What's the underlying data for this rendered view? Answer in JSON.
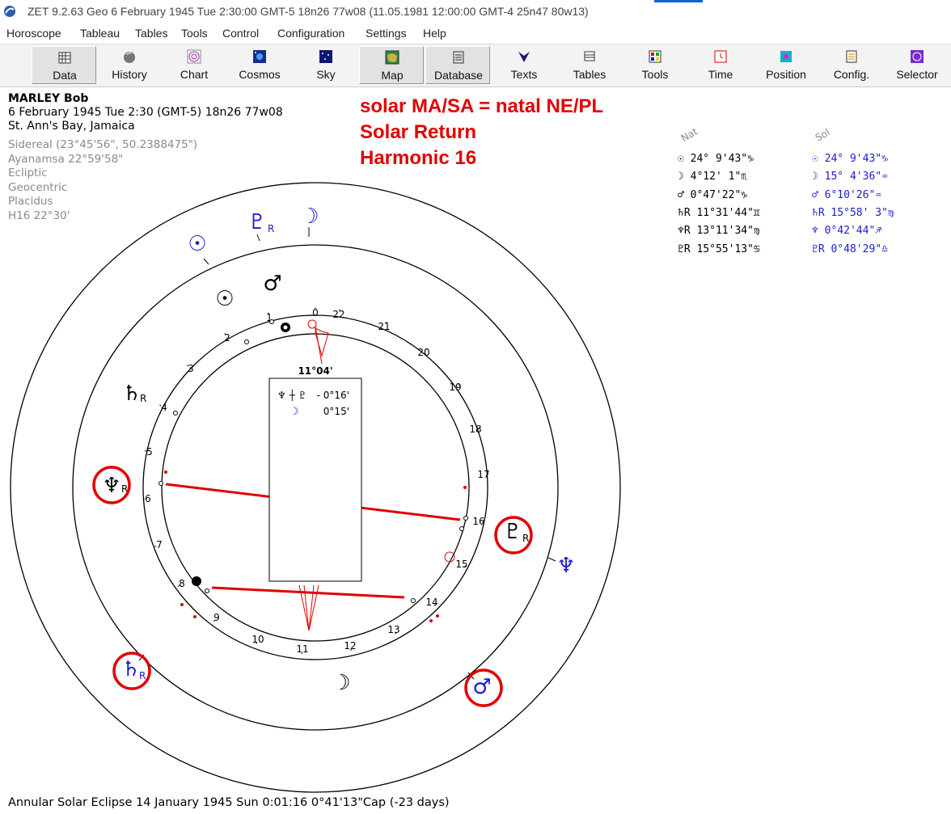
{
  "window": {
    "title": "ZET 9.2.63 Geo    6 February 1945  Tue   2:30:00 GMT-5 18n26  77w08  (11.05.1981  12:00:00 GMT-4 25n47 80w13)"
  },
  "menu": [
    "Horoscope",
    "Tableau",
    "Tables",
    "Tools",
    "Control",
    "Configuration",
    "Settings",
    "Help"
  ],
  "toolbar": [
    {
      "label": "Data",
      "icon": "calendar-icon",
      "pressed": true
    },
    {
      "label": "History",
      "icon": "history-icon",
      "pressed": false
    },
    {
      "label": "Chart",
      "icon": "chart-wheel-icon",
      "pressed": false
    },
    {
      "label": "Cosmos",
      "icon": "cosmos-icon",
      "pressed": false
    },
    {
      "label": "Sky",
      "icon": "sky-icon",
      "pressed": false
    },
    {
      "label": "Map",
      "icon": "map-icon",
      "pressed": true
    },
    {
      "label": "Database",
      "icon": "database-icon",
      "pressed": true
    },
    {
      "label": "Texts",
      "icon": "texts-icon",
      "pressed": false
    },
    {
      "label": "Tables",
      "icon": "tables-icon",
      "pressed": false
    },
    {
      "label": "Tools",
      "icon": "tools-icon",
      "pressed": false
    },
    {
      "label": "Time",
      "icon": "time-icon",
      "pressed": false
    },
    {
      "label": "Position",
      "icon": "position-icon",
      "pressed": false
    },
    {
      "label": "Config.",
      "icon": "config-icon",
      "pressed": false
    },
    {
      "label": "Selector",
      "icon": "selector-icon",
      "pressed": false
    }
  ],
  "header": {
    "name": "MARLEY Bob",
    "datetime": "6 February 1945  Tue   2:30 (GMT-5) 18n26  77w08",
    "place": "St. Ann's Bay, Jamaica",
    "settings": [
      "Sidereal (23°45'56\", 50.2388475\")",
      "Ayanamsa 22°59'58\"",
      "Ecliptic",
      "Geocentric",
      "Placidus",
      "H16  22°30'"
    ]
  },
  "annotation": [
    "solar MA/SA = natal NE/PL",
    "Solar Return",
    "Harmonic 16"
  ],
  "table": {
    "nat_header": "Nat",
    "sol_header": "Sol",
    "rows": [
      {
        "nat": "☉   24° 9'43\"♑",
        "sol": "☉  24° 9'43\"♑"
      },
      {
        "nat": "☽    4°12' 1\"♏",
        "sol": "☽  15° 4'36\"♒"
      },
      {
        "nat": "♂    0°47'22\"♑",
        "sol": "♂   6°10'26\"♒"
      },
      {
        "nat": "♄R 11°31'44\"♊",
        "sol": "♄R 15°58' 3\"♍"
      },
      {
        "nat": "♆R 13°11'34\"♍",
        "sol": "♆   0°42'44\"♐"
      },
      {
        "nat": "♇R 15°55'13\"♋",
        "sol": "♇R  0°48'29\"♎"
      }
    ]
  },
  "wheel": {
    "center_label": "11°04'",
    "box_rows": [
      {
        "glyphs": "♆ ┼ ♇",
        "value": "- 0°16'"
      },
      {
        "glyphs": "☽",
        "value": "0°15'"
      }
    ],
    "house_numbers": [
      "0",
      "1",
      "2",
      "3",
      "4",
      "5",
      "6",
      "7",
      "8",
      "9",
      "10",
      "11",
      "12",
      "13",
      "14",
      "15",
      "16",
      "17",
      "18",
      "19",
      "20",
      "21",
      "22"
    ],
    "inner_planets": [
      "☉",
      "♂",
      "♄",
      "♆",
      "♇",
      "☽"
    ],
    "outer_planets": [
      "☉",
      "♇",
      "☽",
      "♆",
      "♂",
      "♄"
    ],
    "retro_mark": "R"
  },
  "colors": {
    "highlight": "#e00000",
    "solar": "#1a1ad0",
    "natal": "#000000"
  },
  "status": "Annular Solar Eclipse 14 January 1945 Sun  0:01:16  0°41'13\"Cap (-23 days)"
}
